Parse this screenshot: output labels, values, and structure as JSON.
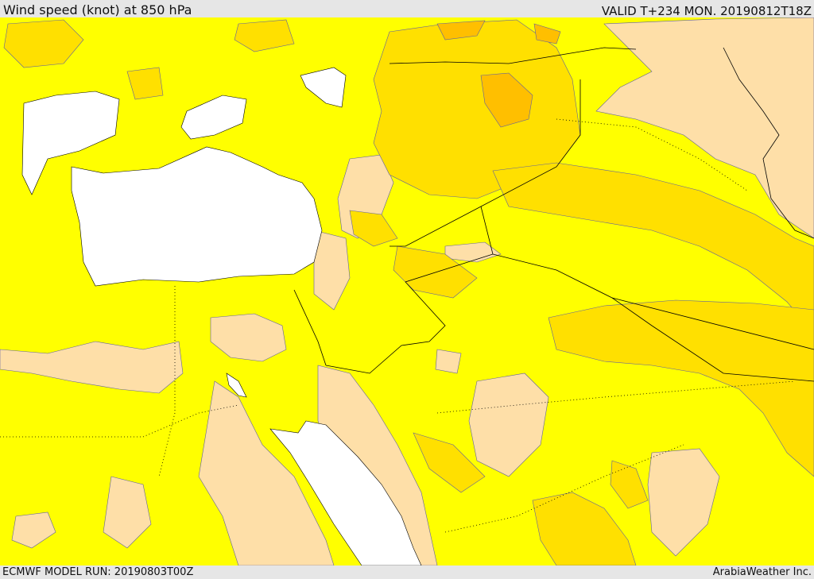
{
  "header": {
    "title": "Wind speed (knot) at 850 hPa",
    "valid": "VALID T+234 MON. 20190812T18Z"
  },
  "footer": {
    "model_run": "ECMWF MODEL RUN: 20190803T00Z",
    "brand": "ArabiaWeather Inc."
  },
  "colors": {
    "sea": "#ffffff",
    "level1": "#ffff00",
    "level2": "#fedfa8",
    "level3": "#ffe000",
    "level4": "#ffbf00",
    "border": "#000000",
    "contour": "#6060a0"
  }
}
